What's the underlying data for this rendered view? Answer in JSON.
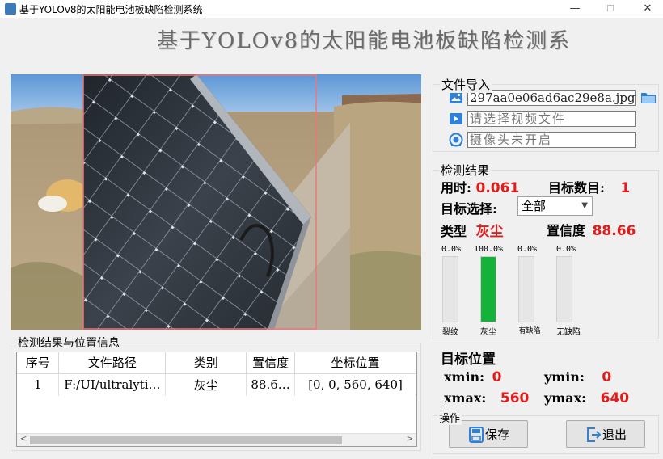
{
  "window": {
    "title": "基于YOLOv8的太阳能电池板缺陷检测系统",
    "min": "—",
    "max": "☐",
    "close": "✕"
  },
  "banner": "基于YOLOv8的太阳能电池板缺陷检测系",
  "file_import": {
    "label": "文件导入",
    "image_path": "297aa0e06ad6ac29e8a.jpg",
    "video_placeholder": "请选择视频文件",
    "camera_status": "摄像头未开启"
  },
  "detection": {
    "label": "检测结果",
    "time_label": "用时:",
    "time_value": "0.061",
    "count_label": "目标数目:",
    "count_value": "1",
    "target_select_label": "目标选择:",
    "target_select_value": "全部",
    "type_label": "类型",
    "type_value": "灰尘",
    "conf_label": "置信度",
    "conf_value": "88.66"
  },
  "class_bars": [
    {
      "label": "裂纹",
      "percent_text": "0.0%",
      "value": 0.0
    },
    {
      "label": "灰尘",
      "percent_text": "100.0%",
      "value": 1.0
    },
    {
      "label": "有缺陷",
      "percent_text": "0.0%",
      "value": 0.0
    },
    {
      "label": "无缺陷",
      "percent_text": "0.0%",
      "value": 0.0
    }
  ],
  "position": {
    "label": "目标位置",
    "xmin_label": "xmin:",
    "xmin": "0",
    "ymin_label": "ymin:",
    "ymin": "0",
    "xmax_label": "xmax:",
    "xmax": "560",
    "ymax_label": "ymax:",
    "ymax": "640"
  },
  "results_table": {
    "label": "检测结果与位置信息",
    "headers": [
      "序号",
      "文件路径",
      "类别",
      "置信度",
      "坐标位置"
    ],
    "rows": [
      [
        "1",
        "F:/UI/ultralyti…",
        "灰尘",
        "88.6…",
        "[0, 0, 560, 640]"
      ]
    ]
  },
  "operations": {
    "label": "操作",
    "save": "保存",
    "exit": "退出"
  },
  "colors": {
    "accent_red": "#e21b1b",
    "bar_green": "#15b23a",
    "detection_box": "#e8787c"
  }
}
